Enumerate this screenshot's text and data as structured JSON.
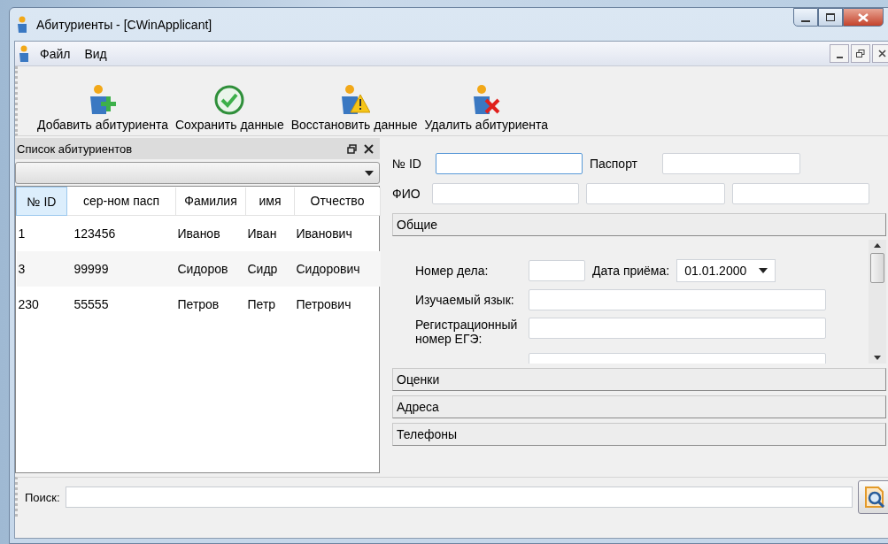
{
  "window": {
    "title": "Абитуриенты - [CWinApplicant]"
  },
  "menu": [
    "Файл",
    "Вид"
  ],
  "toolbar": [
    {
      "label": "Добавить абитуриента",
      "kind": "add"
    },
    {
      "label": "Сохранить данные",
      "kind": "save"
    },
    {
      "label": "Восстановить данные",
      "kind": "restore"
    },
    {
      "label": "Удалить абитуриента",
      "kind": "delete"
    }
  ],
  "list_panel": {
    "title": "Список абитуриентов",
    "columns": [
      "№ ID",
      "сер-ном пасп",
      "Фамилия",
      "имя",
      "Отчество"
    ],
    "rows": [
      [
        "1",
        "123456",
        "Иванов",
        "Иван",
        "Иванович"
      ],
      [
        "3",
        "99999",
        "Сидоров",
        "Сидр",
        "Сидорович"
      ],
      [
        "230",
        "55555",
        "Петров",
        "Петр",
        "Петрович"
      ]
    ]
  },
  "form": {
    "id_label": "№ ID",
    "id_focused": true,
    "passport_label": "Паспорт",
    "fio_label": "ФИО",
    "sections": [
      {
        "title": "Общие",
        "content": {
          "case_number_label": "Номер дела:",
          "date_label": "Дата приёма:",
          "date_value": "01.01.2000",
          "language_label": "Изучаемый язык:",
          "ege_label": "Регистрационный номер ЕГЭ:"
        }
      },
      {
        "title": "Оценки"
      },
      {
        "title": "Адреса"
      },
      {
        "title": "Телефоны"
      }
    ]
  },
  "search": {
    "label": "Поиск:"
  }
}
